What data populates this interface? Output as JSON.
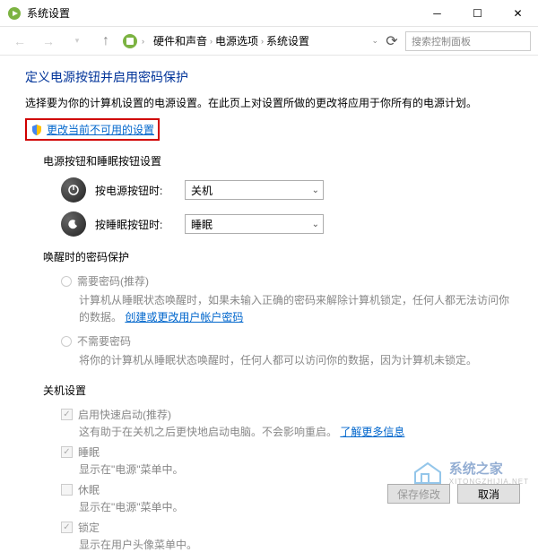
{
  "window": {
    "title": "系统设置"
  },
  "breadcrumb": {
    "items": [
      "硬件和声音",
      "电源选项",
      "系统设置"
    ]
  },
  "search": {
    "placeholder": "搜索控制面板"
  },
  "page": {
    "title": "定义电源按钮并启用密码保护",
    "desc": "选择要为你的计算机设置的电源设置。在此页上对设置所做的更改将应用于你所有的电源计划。",
    "change_link": "更改当前不可用的设置"
  },
  "power_buttons": {
    "section_title": "电源按钮和睡眠按钮设置",
    "rows": [
      {
        "label": "按电源按钮时:",
        "value": "关机"
      },
      {
        "label": "按睡眠按钮时:",
        "value": "睡眠"
      }
    ]
  },
  "wake_protect": {
    "section_title": "唤醒时的密码保护",
    "options": [
      {
        "label": "需要密码(推荐)",
        "desc_prefix": "计算机从睡眠状态唤醒时，如果未输入正确的密码来解除计算机锁定，任何人都无法访问你的数据。",
        "link": "创建或更改用户帐户密码"
      },
      {
        "label": "不需要密码",
        "desc": "将你的计算机从睡眠状态唤醒时，任何人都可以访问你的数据，因为计算机未锁定。"
      }
    ]
  },
  "shutdown": {
    "section_title": "关机设置",
    "items": [
      {
        "label": "启用快速启动(推荐)",
        "checked": true,
        "desc": "这有助于在关机之后更快地启动电脑。不会影响重启。",
        "link": "了解更多信息"
      },
      {
        "label": "睡眠",
        "checked": true,
        "desc": "显示在\"电源\"菜单中。"
      },
      {
        "label": "休眠",
        "checked": false,
        "desc": "显示在\"电源\"菜单中。"
      },
      {
        "label": "锁定",
        "checked": true,
        "desc": "显示在用户头像菜单中。"
      }
    ]
  },
  "footer": {
    "save": "保存修改",
    "cancel": "取消"
  },
  "watermark": {
    "name": "系统之家",
    "url": "XITONGZHIJIA.NET"
  }
}
